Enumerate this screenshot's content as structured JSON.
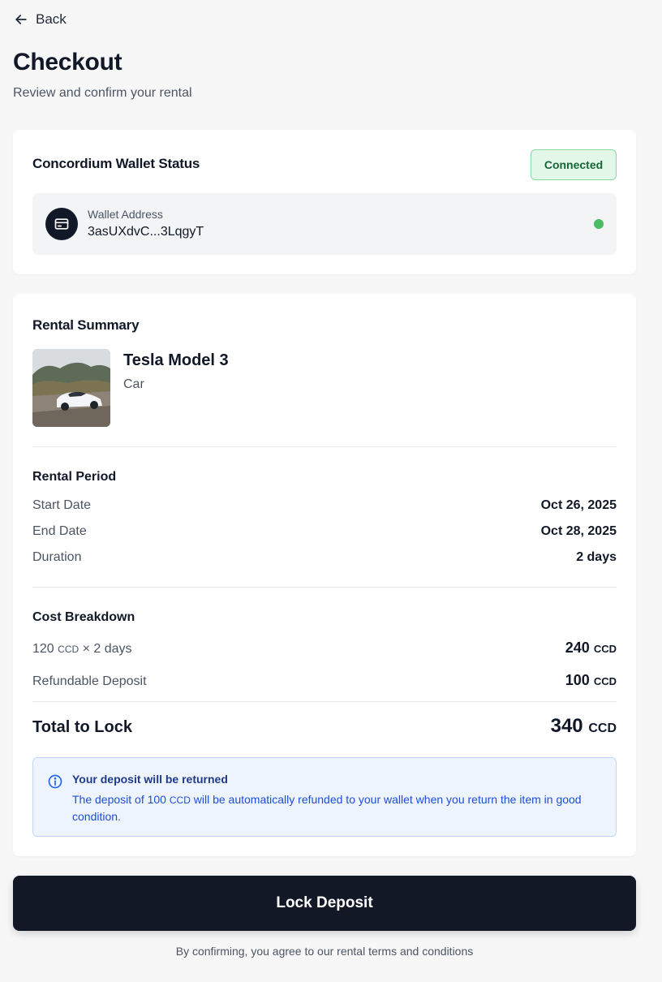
{
  "header": {
    "back_label": "Back",
    "title": "Checkout",
    "subtitle": "Review and confirm your rental"
  },
  "wallet": {
    "heading": "Concordium Wallet Status",
    "status_badge": "Connected",
    "address_label": "Wallet Address",
    "address_value": "3asUXdvC...3LqgyT",
    "status_color": "#4cbb66"
  },
  "summary": {
    "heading": "Rental Summary",
    "item": {
      "name": "Tesla Model 3",
      "type": "Car"
    },
    "period": {
      "label": "Rental Period",
      "start_label": "Start Date",
      "start_value": "Oct 26, 2025",
      "end_label": "End Date",
      "end_value": "Oct 28, 2025",
      "duration_label": "Duration",
      "duration_value": "2 days"
    },
    "cost": {
      "label": "Cost Breakdown",
      "rate_prefix": "120",
      "rate_unit": "CCD",
      "rate_suffix": "× 2 days",
      "rate_total": "240",
      "rate_total_unit": "CCD",
      "deposit_label": "Refundable Deposit",
      "deposit_value": "100",
      "deposit_unit": "CCD",
      "total_label": "Total to Lock",
      "total_value": "340",
      "total_unit": "CCD"
    },
    "info": {
      "title": "Your deposit will be returned",
      "text_before": "The deposit of 100",
      "text_unit": "CCD",
      "text_after": "will be automatically refunded to your wallet when you return the item in good condition."
    }
  },
  "actions": {
    "lock_button": "Lock Deposit",
    "terms": "By confirming, you agree to our rental terms and conditions"
  }
}
